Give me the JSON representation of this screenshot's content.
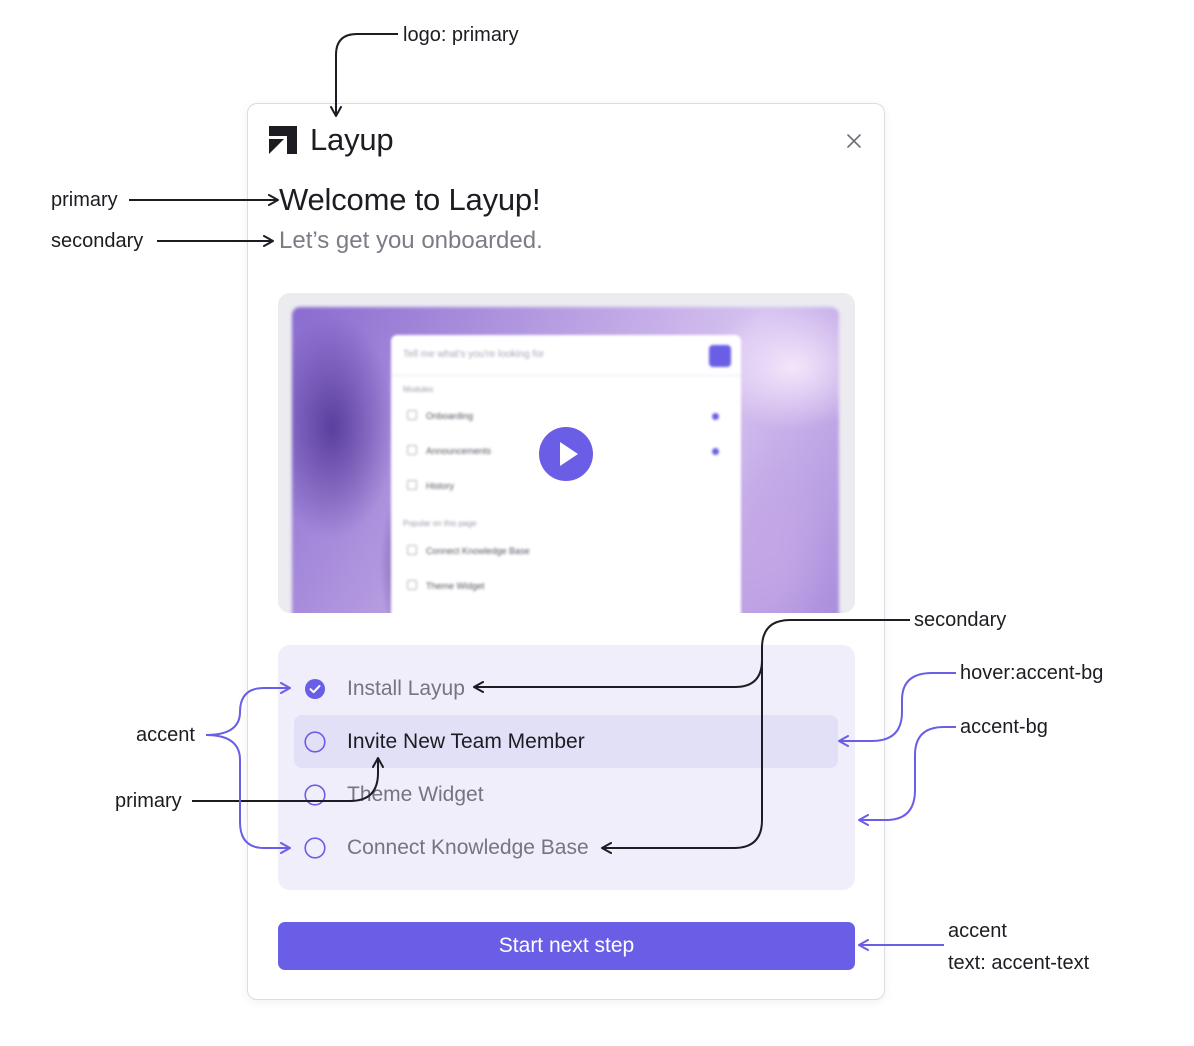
{
  "colors": {
    "primary": "#1c1c22",
    "secondary": "#7c7c86",
    "accent": "#6a5ee6",
    "accent_bg": "#efeefa",
    "hover_accent_bg": "#e2e0f6",
    "accent_text": "#ffffff"
  },
  "annotations": {
    "logo": "logo: primary",
    "title": "primary",
    "subtitle": "secondary",
    "accent": "accent",
    "primary_task": "primary",
    "secondary_tasks": "secondary",
    "hover_bg": "hover:accent-bg",
    "accent_bg": "accent-bg",
    "button_accent": "accent",
    "button_text": "text: accent-text"
  },
  "modal": {
    "logo_text": "Layup",
    "logo_icon": "layup-logo-icon",
    "close_icon": "close-icon",
    "title": "Welcome to Layup!",
    "subtitle": "Let’s get you onboarded.",
    "video": {
      "play_icon": "play-icon",
      "search_placeholder": "Tell me what's you're looking for",
      "section_modules": "Modules",
      "modules": [
        "Onboarding",
        "Announcements",
        "History"
      ],
      "section_popular": "Popular on this page",
      "popular": [
        "Connect Knowledge Base",
        "Theme Widget"
      ]
    },
    "tasks": [
      {
        "label": "Install Layup",
        "completed": true,
        "state": "secondary"
      },
      {
        "label": "Invite New Team Member",
        "completed": false,
        "state": "hover"
      },
      {
        "label": "Theme Widget",
        "completed": false,
        "state": "secondary"
      },
      {
        "label": "Connect Knowledge Base",
        "completed": false,
        "state": "secondary"
      }
    ],
    "cta_label": "Start next step"
  }
}
